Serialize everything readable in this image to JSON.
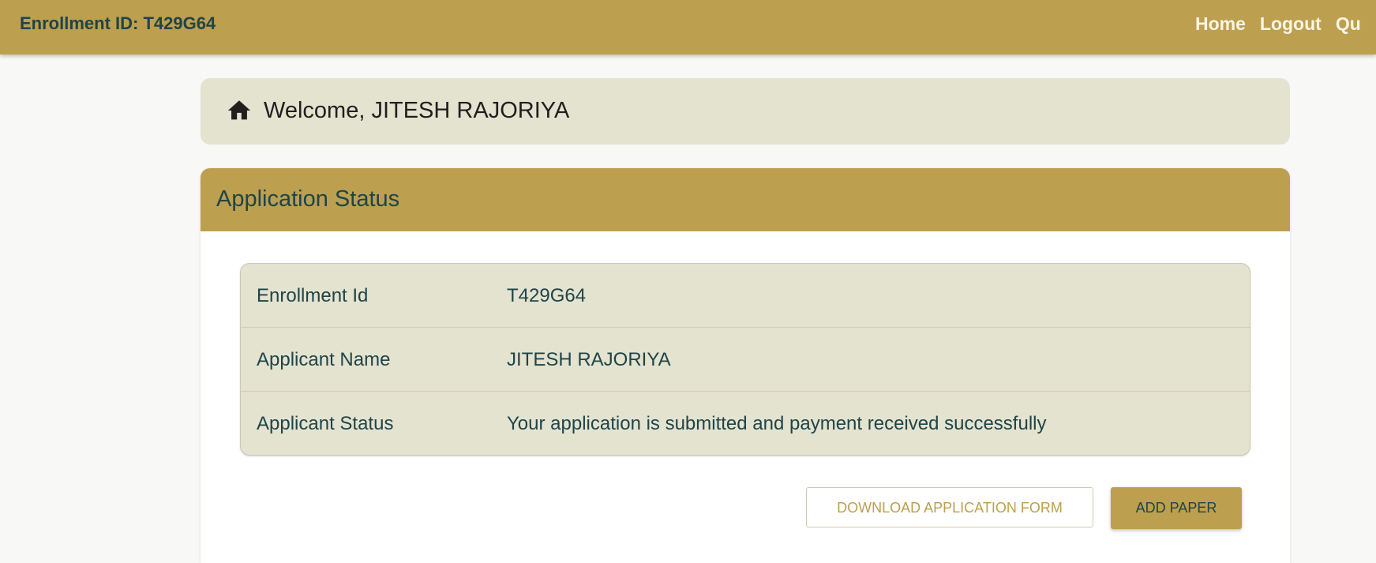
{
  "header": {
    "enrollment_title": "Enrollment ID: T429G64",
    "nav": [
      {
        "label": "Home"
      },
      {
        "label": "Logout"
      },
      {
        "label": "Qu"
      }
    ]
  },
  "welcome": {
    "icon": "home-icon",
    "text": "Welcome, JITESH RAJORIYA"
  },
  "status_card": {
    "title": "Application Status",
    "rows": [
      {
        "label": "Enrollment Id",
        "value": "T429G64"
      },
      {
        "label": "Applicant Name",
        "value": "JITESH RAJORIYA"
      },
      {
        "label": "Applicant Status",
        "value": "Your application is submitted and payment received successfully"
      }
    ],
    "download_label": "DOWNLOAD APPLICATION FORM",
    "add_paper_label": "ADD PAPER"
  },
  "colors": {
    "brand_gold": "#bc9f4f",
    "panel_beige": "#e4e3d0",
    "text_teal": "#1f4448"
  }
}
